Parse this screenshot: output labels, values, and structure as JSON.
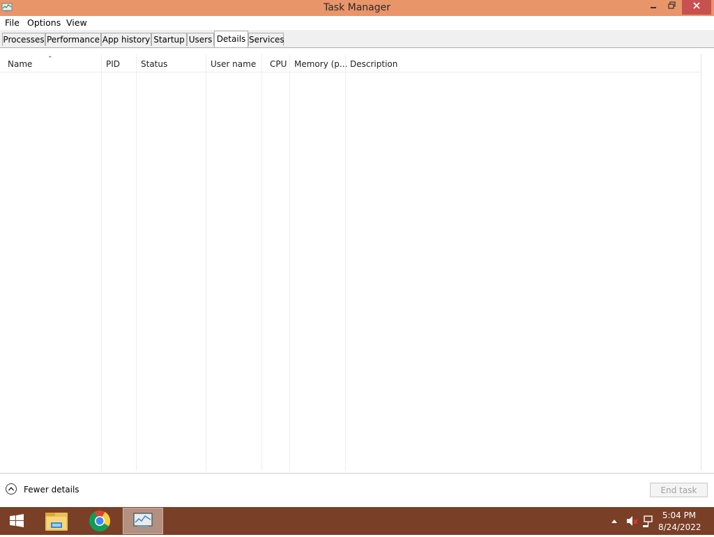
{
  "window": {
    "title": "Task Manager",
    "titlebar_color": "#e9956a",
    "icons": [
      "task-manager-icon",
      "minimize-icon",
      "restore-icon",
      "close-icon"
    ]
  },
  "menu": [
    "File",
    "Options",
    "View"
  ],
  "tabs": [
    {
      "label": "Processes"
    },
    {
      "label": "Performance"
    },
    {
      "label": "App history"
    },
    {
      "label": "Startup"
    },
    {
      "label": "Users"
    },
    {
      "label": "Details",
      "active": true
    },
    {
      "label": "Services"
    }
  ],
  "columns": [
    "Name",
    "PID",
    "Status",
    "User name",
    "CPU",
    "Memory (p...",
    "Description"
  ],
  "sort": {
    "column": "Name",
    "direction": "ascending"
  },
  "rows": [],
  "footer": {
    "fewer_details": "Fewer details",
    "end_task": "End task"
  },
  "taskbar": {
    "color": "#7a3f27",
    "items": [
      "windows-start-icon",
      "file-explorer-icon",
      "chrome-icon",
      "task-manager-icon"
    ],
    "active_item": "task-manager-icon",
    "tray_icons": [
      "show-hidden-icons-chevron",
      "speaker-muted-icon",
      "network-icon"
    ],
    "time": "5:04 PM",
    "date": "8/24/2022"
  }
}
